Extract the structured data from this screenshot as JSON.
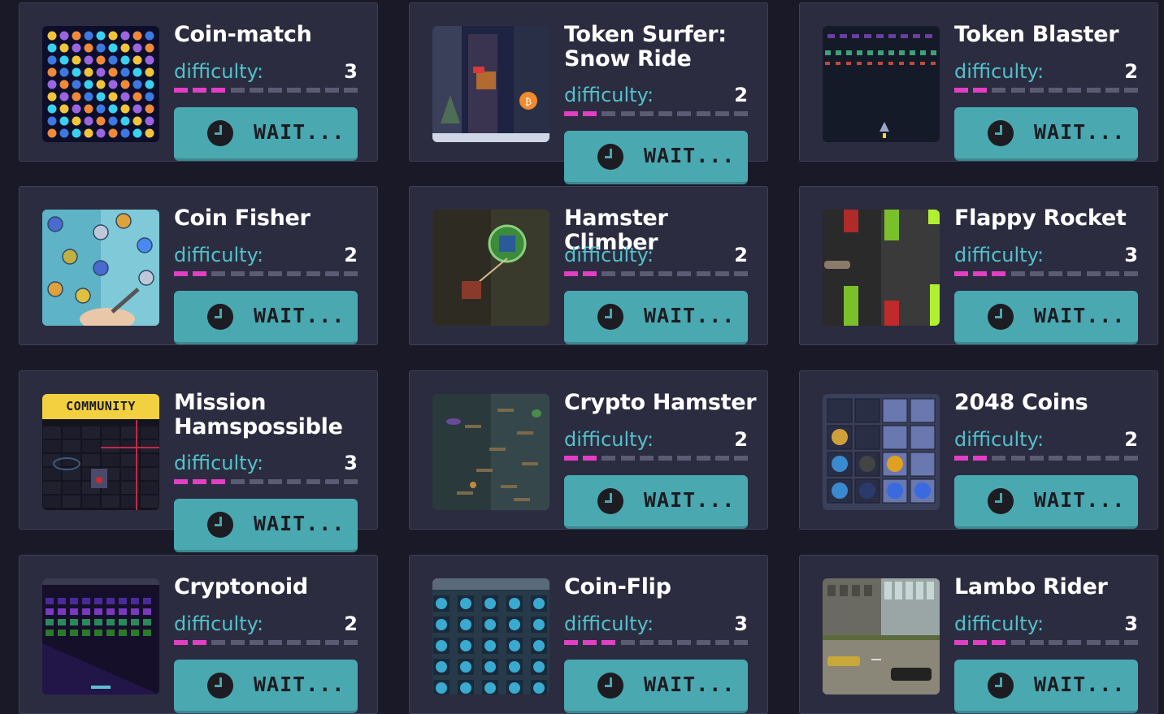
{
  "wait_label": "WAIT...",
  "difficulty_label": "difficulty:",
  "colors": {
    "accent_on": "#e23fc5",
    "accent_off": "#5b5b74",
    "button": "#4aa8b0",
    "label": "#51c2cc"
  },
  "games": [
    {
      "title": "Coin-match",
      "difficulty": 3,
      "thumb": "coin-match"
    },
    {
      "title": "Token Surfer: Snow Ride",
      "difficulty": 2,
      "thumb": "token-surfer"
    },
    {
      "title": "Token Blaster",
      "difficulty": 2,
      "thumb": "token-blaster"
    },
    {
      "title": "Coin Fisher",
      "difficulty": 2,
      "thumb": "coin-fisher"
    },
    {
      "title": "Hamster Climber",
      "difficulty": 2,
      "thumb": "hamster-climber"
    },
    {
      "title": "Flappy Rocket",
      "difficulty": 3,
      "thumb": "flappy-rocket"
    },
    {
      "title": "Mission Hamspossible",
      "difficulty": 3,
      "thumb": "mission-hamspossible",
      "badge": "COMMUNITY"
    },
    {
      "title": "Crypto Hamster",
      "difficulty": 2,
      "thumb": "crypto-hamster"
    },
    {
      "title": "2048 Coins",
      "difficulty": 2,
      "thumb": "2048-coins"
    },
    {
      "title": "Cryptonoid",
      "difficulty": 2,
      "thumb": "cryptonoid"
    },
    {
      "title": "Coin-Flip",
      "difficulty": 3,
      "thumb": "coin-flip"
    },
    {
      "title": "Lambo Rider",
      "difficulty": 3,
      "thumb": "lambo-rider"
    }
  ]
}
